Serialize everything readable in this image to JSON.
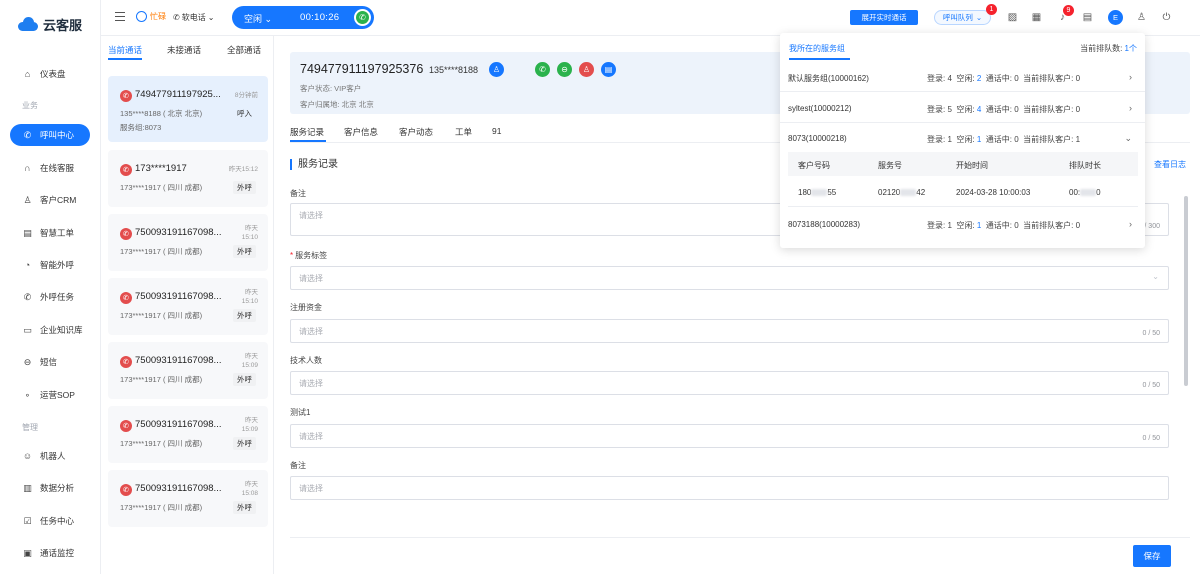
{
  "brand": {
    "name": "云客服"
  },
  "sidebar": {
    "section_business": "业务",
    "section_manage": "管理",
    "items": [
      {
        "label": "仪表盘",
        "icon": "home-icon"
      },
      {
        "label": "呼叫中心",
        "icon": "phone-icon",
        "active": true
      },
      {
        "label": "在线客服",
        "icon": "headset-icon"
      },
      {
        "label": "客户CRM",
        "icon": "user-icon"
      },
      {
        "label": "智慧工单",
        "icon": "document-icon"
      },
      {
        "label": "智能外呼",
        "icon": "outbound-call-icon"
      },
      {
        "label": "外呼任务",
        "icon": "task-call-icon"
      },
      {
        "label": "企业知识库",
        "icon": "book-icon"
      },
      {
        "label": "短信",
        "icon": "message-icon"
      },
      {
        "label": "运营SOP",
        "icon": "flow-icon"
      },
      {
        "label": "机器人",
        "icon": "robot-icon"
      },
      {
        "label": "数据分析",
        "icon": "chart-icon"
      },
      {
        "label": "任务中心",
        "icon": "checklist-icon"
      },
      {
        "label": "通话监控",
        "icon": "monitor-icon"
      }
    ]
  },
  "header": {
    "busy_label": "忙碌",
    "softphone_label": "软电话",
    "status": "空闲",
    "timer": "00:10:26",
    "realtime_button": "展开实时通话",
    "queue_button": "呼叫队列",
    "queue_badge": "1",
    "bell_badge": "9",
    "avatar_letter": "E"
  },
  "calllist": {
    "tabs": [
      "当前通话",
      "未接通话",
      "全部通话"
    ],
    "cards": [
      {
        "number": "749477911197925...",
        "time": "8分钟前",
        "sub": "135****8188 ( 北京 北京)",
        "tag": "呼入",
        "group": "服务组:8073"
      },
      {
        "number": "173****1917",
        "time": "昨天15:12",
        "sub": "173****1917 ( 四川 成都)",
        "tag": "外呼"
      },
      {
        "number": "750093191167098...",
        "time": "昨天 15:10",
        "sub": "173****1917 ( 四川 成都)",
        "tag": "外呼"
      },
      {
        "number": "750093191167098...",
        "time": "昨天 15:10",
        "sub": "173****1917 ( 四川 成都)",
        "tag": "外呼"
      },
      {
        "number": "750093191167098...",
        "time": "昨天 15:09",
        "sub": "173****1917 ( 四川 成都)",
        "tag": "外呼"
      },
      {
        "number": "750093191167098...",
        "time": "昨天 15:09",
        "sub": "173****1917 ( 四川 成都)",
        "tag": "外呼"
      },
      {
        "number": "750093191167098...",
        "time": "昨天 15:08",
        "sub": "173****1917 ( 四川 成都)",
        "tag": "外呼"
      }
    ]
  },
  "customer": {
    "id": "749477911197925376",
    "phone": "135****8188",
    "status": "客户状态: VIP客户",
    "location": "客户归属地: 北京 北京"
  },
  "main": {
    "tabs": [
      "服务记录",
      "客户信息",
      "客户动态",
      "工单",
      "91"
    ],
    "section_title": "服务记录",
    "view_log": "查看日志",
    "save": "保存",
    "fields": [
      {
        "label": "备注",
        "placeholder": "请选择",
        "count": "/ 300"
      },
      {
        "label": "服务标签",
        "required": true,
        "placeholder": "请选择",
        "count": ""
      },
      {
        "label": "注册资金",
        "placeholder": "请选择",
        "count": "0 / 50"
      },
      {
        "label": "技术人数",
        "placeholder": "请选择",
        "count": "0 / 50"
      },
      {
        "label": "测试1",
        "placeholder": "请选择",
        "count": "0 / 50"
      },
      {
        "label": "备注",
        "placeholder": "请选择",
        "count": ""
      }
    ]
  },
  "popover": {
    "title": "我所在的服务组",
    "queue_count_label": "当前排队数:",
    "queue_count_value": "1个",
    "groups": [
      {
        "name": "默认服务组(10000162)",
        "login": "4",
        "idle": "2",
        "calling": "0",
        "queue": "0"
      },
      {
        "name": "syltest(10000212)",
        "login": "5",
        "idle": "4",
        "calling": "0",
        "queue": "0"
      },
      {
        "name": "8073(10000218)",
        "login": "1",
        "idle": "1",
        "calling": "0",
        "queue": "1"
      },
      {
        "name": "8073188(10000283)",
        "login": "1",
        "idle": "1",
        "calling": "0",
        "queue": "0"
      }
    ],
    "stat_labels": {
      "login": "登录:",
      "idle": "空闲:",
      "calling": "通话中:",
      "queue": "当前排队客户:"
    },
    "table": {
      "headers": [
        "客户号码",
        "服务号",
        "开始时间",
        "排队时长"
      ],
      "row": {
        "customer_number_a": "180",
        "customer_number_b": "55",
        "service_number_a": "02120",
        "service_number_b": "42",
        "start_time": "2024-03-28 10:00:03",
        "wait_a": "00:",
        "wait_b": "0"
      }
    }
  }
}
